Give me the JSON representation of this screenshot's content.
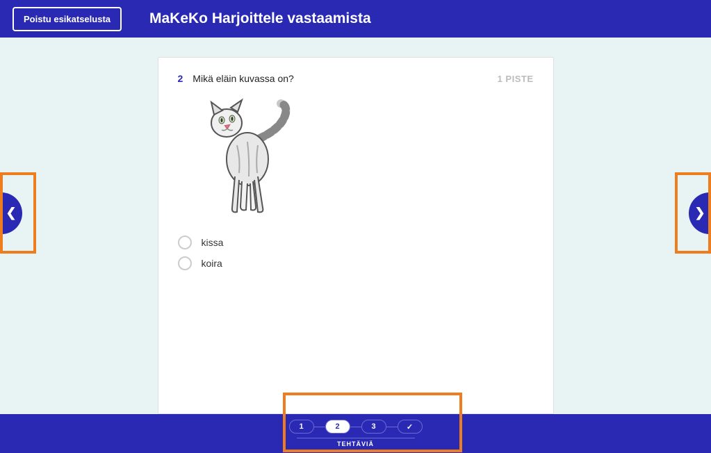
{
  "header": {
    "exit_button": "Poistu esikatselusta",
    "title": "MaKeKo Harjoittele vastaamista"
  },
  "question": {
    "number": "2",
    "text": "Mikä eläin kuvassa on?",
    "points": "1 PISTE",
    "image_alt": "cat",
    "options": [
      "kissa",
      "koira"
    ]
  },
  "footer": {
    "pages": [
      "1",
      "2",
      "3"
    ],
    "active_page": 2,
    "label": "TEHTÄVIÄ"
  }
}
